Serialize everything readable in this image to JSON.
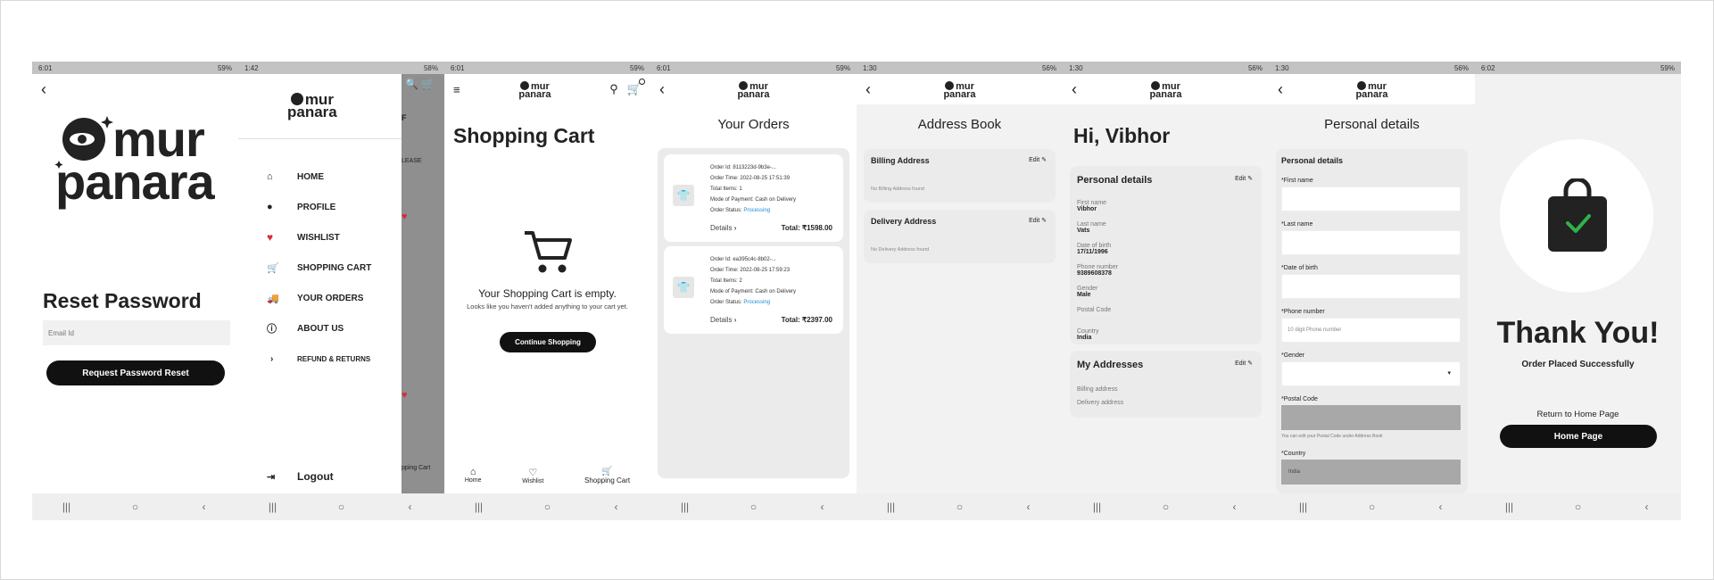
{
  "colors": {
    "accent": "#1a8bd6",
    "black": "#111111",
    "status_bar": "#c3c3c3",
    "panel": "#ebebeb",
    "heart": "#d62b3a",
    "check": "#2fb34a"
  },
  "logo": {
    "line1": "mur",
    "line2": "panara"
  },
  "screen1": {
    "status_time": "6:01",
    "status_right": "59%",
    "title": "Reset Password",
    "email_placeholder": "Email Id",
    "button": "Request Password Reset"
  },
  "screen2": {
    "status_time": "1:42",
    "status_right": "58%",
    "menu": [
      {
        "label": "HOME",
        "icon": "home-icon"
      },
      {
        "label": "PROFILE",
        "icon": "profile-icon"
      },
      {
        "label": "WISHLIST",
        "icon": "heart-icon"
      },
      {
        "label": "SHOPPING CART",
        "icon": "cart-icon"
      },
      {
        "label": "YOUR ORDERS",
        "icon": "truck-icon"
      },
      {
        "label": "ABOUT US",
        "icon": "info-icon"
      },
      {
        "label": "REFUND & RETURNS",
        "icon": "chevron-right-icon"
      }
    ],
    "logout": "Logout",
    "behind_1": "F",
    "behind_2": "LEASE",
    "behind_3": "pping Cart"
  },
  "screen3": {
    "status_time": "6:01",
    "status_right": "59%",
    "title": "Shopping Cart",
    "empty_title": "Your Shopping Cart is empty.",
    "empty_sub": "Looks like you haven't added anything to your cart yet.",
    "button": "Continue Shopping",
    "tabs": [
      "Home",
      "Wishlist",
      "Shopping Cart"
    ]
  },
  "screen4": {
    "status_time": "6:01",
    "status_right": "59%",
    "title": "Your Orders",
    "orders": [
      {
        "id": "Order Id: 8113223d-9b3e-...",
        "time": "Order Time: 2022-08-25 17:51:39",
        "items": "Total Items: 1",
        "payment": "Mode of Payment: Cash on Delivery",
        "status_label": "Order Status: ",
        "status": "Processing",
        "details": "Details",
        "total": "Total: ₹1598.00"
      },
      {
        "id": "Order Id: ea395c4c-8b02-...",
        "time": "Order Time: 2022-08-25 17:59:23",
        "items": "Total Items: 2",
        "payment": "Mode of Payment: Cash on Delivery",
        "status_label": "Order Status: ",
        "status": "Processing",
        "details": "Details",
        "total": "Total: ₹2397.00"
      }
    ]
  },
  "screen5": {
    "status_time": "1:30",
    "status_right": "56%",
    "title": "Address Book",
    "billing": {
      "title": "Billing Address",
      "edit": "Edit",
      "empty": "No Billing Address found"
    },
    "delivery": {
      "title": "Delivery Address",
      "edit": "Edit",
      "empty": "No Delivery Address found"
    }
  },
  "screen6": {
    "status_time": "1:30",
    "status_right": "56%",
    "greeting": "Hi, Vibhor",
    "personal": {
      "title": "Personal details",
      "edit": "Edit",
      "fields": [
        {
          "label": "First name",
          "value": "Vibhor"
        },
        {
          "label": "Last name",
          "value": "Vats"
        },
        {
          "label": "Date of birth",
          "value": "17/11/1996"
        },
        {
          "label": "Phone number",
          "value": "9389608378"
        },
        {
          "label": "Gender",
          "value": "Male"
        },
        {
          "label": "Postal Code",
          "value": ""
        },
        {
          "label": "Country",
          "value": "India"
        }
      ]
    },
    "addresses": {
      "title": "My Addresses",
      "edit": "Edit",
      "items": [
        "Billing address",
        "Delivery address"
      ]
    }
  },
  "screen7": {
    "status_time": "1:30",
    "status_right": "56%",
    "title": "Personal details",
    "panel_title": "Personal details",
    "first_name": "*First name",
    "last_name": "*Last name",
    "dob": "*Date of birth",
    "phone": "*Phone number",
    "phone_placeholder": "10 digit Phone number",
    "gender": "*Gender",
    "postal": "*Postal Code",
    "postal_note": "You can edit your Postal Code under Address Book",
    "country": "*Country",
    "country_value": "India"
  },
  "screen8": {
    "status_time": "6:02",
    "status_right": "59%",
    "title": "Thank You!",
    "subtitle": "Order Placed Successfully",
    "return_label": "Return to Home Page",
    "button": "Home Page"
  },
  "navbar": {
    "recent": "|||",
    "home": "○",
    "back": "‹"
  }
}
